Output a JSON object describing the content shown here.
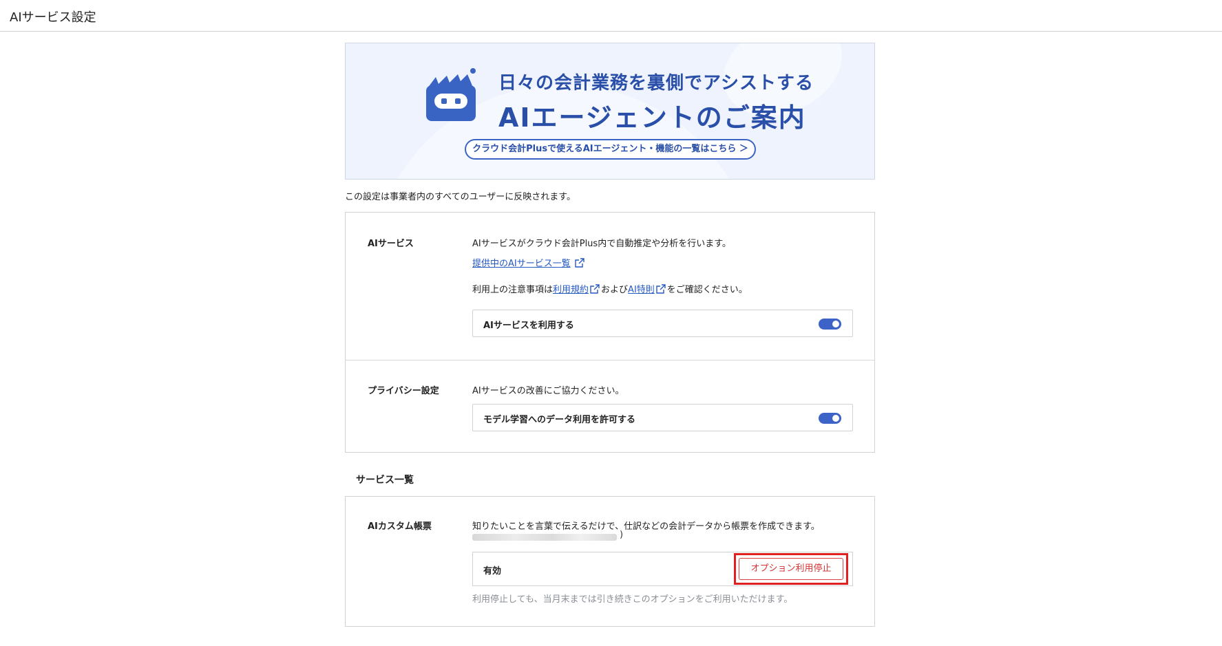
{
  "header": {
    "title": "AIサービス設定"
  },
  "banner": {
    "headline1": "日々の会計業務を裏側でアシストする",
    "headline2": "AIエージェントのご案内",
    "pill_label": "クラウド会計Plusで使えるAIエージェント・機能の一覧はこちら ＞"
  },
  "note": "この設定は事業者内のすべてのユーザーに反映されます。",
  "ai_service": {
    "label": "AIサービス",
    "description": "AIサービスがクラウド会計Plus内で自動推定や分析を行います。",
    "list_link": "提供中のAIサービス一覧",
    "terms_prefix": "利用上の注意事項は",
    "terms_link": "利用規約",
    "terms_mid": "および",
    "special_link": "AI特則",
    "terms_suffix": "をご確認ください。",
    "toggle_label": "AIサービスを利用する",
    "toggle_on": true
  },
  "privacy": {
    "label": "プライバシー設定",
    "description": "AIサービスの改善にご協力ください。",
    "toggle_label": "モデル学習へのデータ利用を許可する",
    "toggle_on": true
  },
  "service_list": {
    "title": "サービス一覧",
    "item": {
      "label": "AIカスタム帳票",
      "description": "知りたいことを言葉で伝えるだけで、仕訳などの会計データから帳票を作成できます。",
      "blurred_paren": ")",
      "status": "有効",
      "stop_button": "オプション利用停止",
      "hint": "利用停止しても、当月末までは引き続きこのオプションをご利用いただけます。"
    }
  },
  "colors": {
    "accent_blue": "#2a4fa8",
    "toggle_on": "#3d63c9",
    "link": "#2459c4",
    "danger": "#d43434",
    "highlight": "#e02020"
  }
}
